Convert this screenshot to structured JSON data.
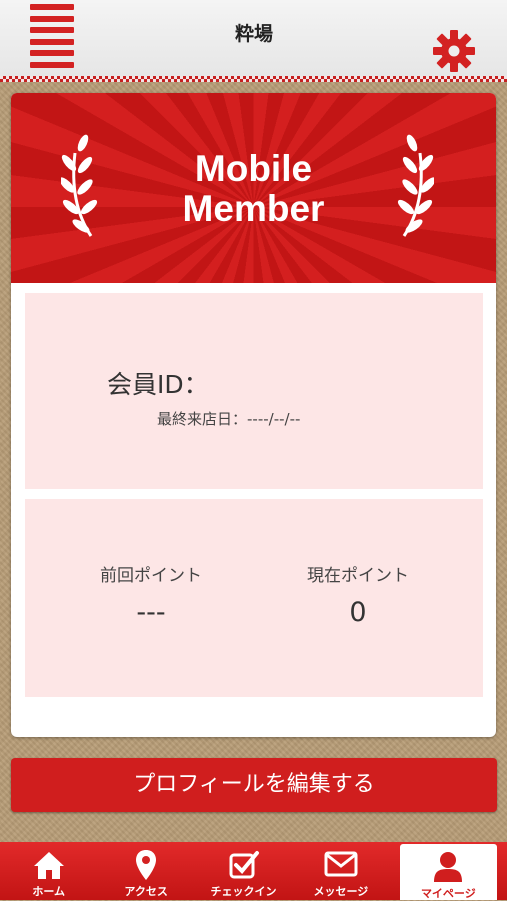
{
  "header": {
    "logo_text": "粋場"
  },
  "banner": {
    "title_line1": "Mobile",
    "title_line2": "Member"
  },
  "member": {
    "id_label": "会員ID：",
    "last_visit": "最終来店日：----/--/--"
  },
  "points": {
    "previous_label": "前回ポイント",
    "previous_value": "---",
    "current_label": "現在ポイント",
    "current_value": "0"
  },
  "edit_button": {
    "label": "プロフィールを編集する"
  },
  "tabs": [
    {
      "label": "ホーム",
      "icon": "home-icon"
    },
    {
      "label": "アクセス",
      "icon": "map-pin-icon"
    },
    {
      "label": "チェックイン",
      "icon": "checkbox-icon"
    },
    {
      "label": "メッセージ",
      "icon": "envelope-icon"
    },
    {
      "label": "マイページ",
      "icon": "user-icon"
    }
  ],
  "colors": {
    "accent_red": "#d01e1e",
    "panel_pink": "#fde6e6",
    "background_tan": "#b79c76"
  }
}
